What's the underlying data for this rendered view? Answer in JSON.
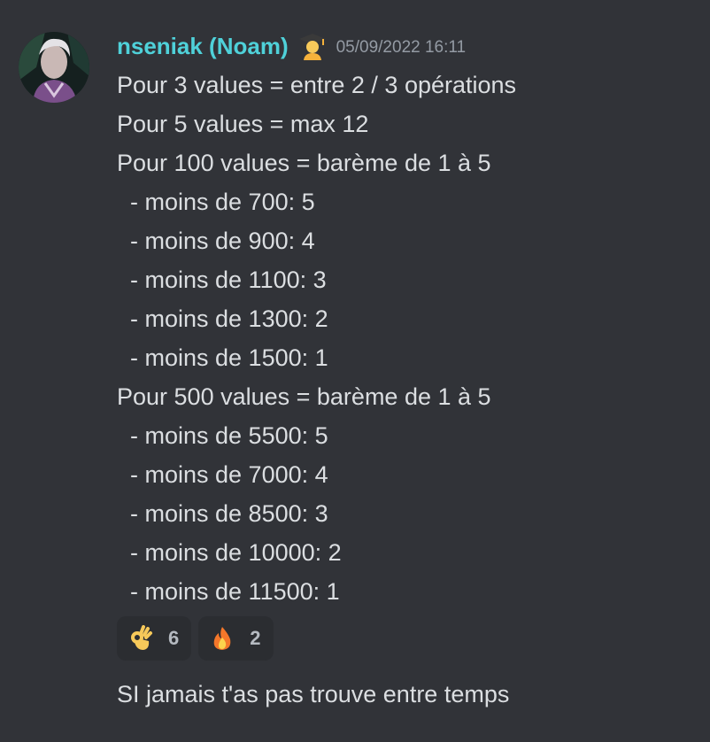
{
  "message": {
    "author": "nseniak (Noam)",
    "badge_icon": "student-emoji-icon",
    "timestamp": "05/09/2022 16:11",
    "lines": [
      "Pour 3 values = entre 2 / 3 opérations",
      "Pour 5 values = max 12",
      "Pour 100 values = barème de 1 à 5",
      "  - moins de 700: 5",
      "  - moins de 900: 4",
      "  - moins de 1100: 3",
      "  - moins de 1300: 2",
      "  - moins de 1500: 1",
      "Pour 500 values = barème de 1 à 5",
      "  - moins de 5500: 5",
      "  - moins de 7000: 4",
      "  - moins de 8500: 3",
      "  - moins de 10000: 2",
      "  - moins de 11500: 1"
    ],
    "reactions": [
      {
        "icon": "ok-hand-emoji-icon",
        "count": "6"
      },
      {
        "icon": "fire-emoji-icon",
        "count": "2"
      }
    ]
  },
  "followup_message": {
    "text": "SI jamais t'as pas trouve entre temps"
  },
  "colors": {
    "background": "#313338",
    "username": "#4fd1d9",
    "text": "#dbdee1",
    "timestamp": "#949ba4",
    "reaction_bg": "#2b2d31"
  }
}
